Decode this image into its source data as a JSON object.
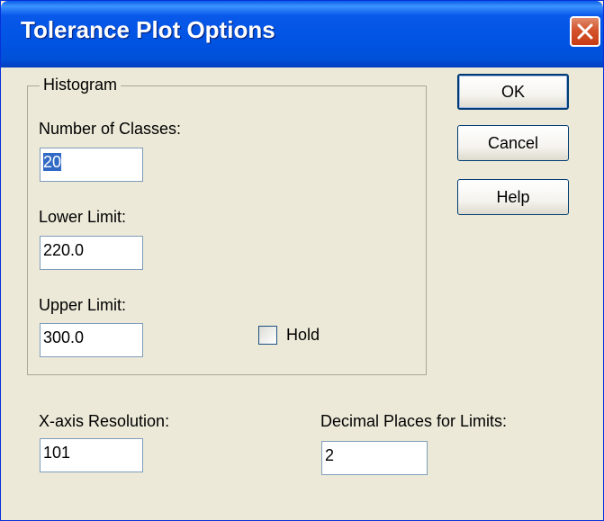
{
  "window": {
    "title": "Tolerance Plot Options"
  },
  "histogram": {
    "legend": "Histogram",
    "classes_label": "Number of Classes:",
    "classes_value": "20",
    "lower_label": "Lower Limit:",
    "lower_value": "220.0",
    "upper_label": "Upper Limit:",
    "upper_value": "300.0",
    "hold_label": "Hold",
    "hold_checked": false
  },
  "resolution": {
    "label": "X-axis Resolution:",
    "value": "101"
  },
  "decimals": {
    "label": "Decimal Places for Limits:",
    "value": "2"
  },
  "buttons": {
    "ok": "OK",
    "cancel": "Cancel",
    "help": "Help"
  },
  "colors": {
    "titlebar": "#0054e3",
    "dialog_bg": "#ece9d8",
    "close": "#c73c14",
    "selection": "#316ac5"
  },
  "icons": {
    "close": "close-icon"
  }
}
